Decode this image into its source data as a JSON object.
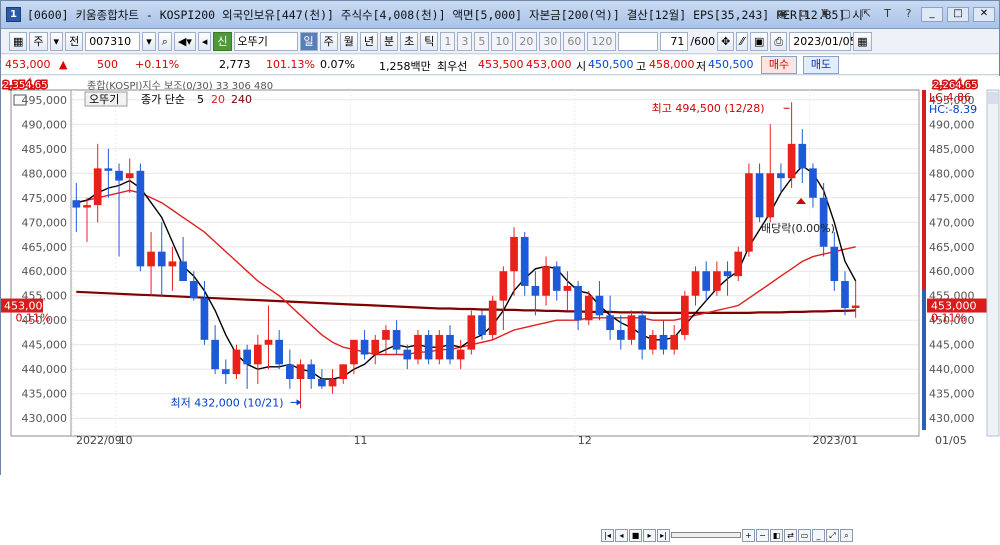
{
  "window": {
    "app_number": "1",
    "title": "[0600] 키움종합차트 - KOSPI200 외국인보유[447(천)] 주식수[4,008(천)] 액면[5,000] 자본금[200(억)] 결산[12월] EPS[35,243] PER[12.85] 시",
    "icons": [
      "chat-icon",
      "copy-icon",
      "lock-icon",
      "restore-icon",
      "resize-icon",
      "text-size-icon",
      "help-icon"
    ],
    "icon_glyphs": [
      "◉",
      "⧉",
      "♜",
      "▢",
      "⇱",
      "T",
      "?"
    ],
    "buttons": {
      "minimize": "_",
      "maximize": "□",
      "close": "✕"
    }
  },
  "toolbar": {
    "market": "주",
    "range": "전",
    "code": "007310",
    "period_type": "오뚜기",
    "period_tabs": [
      "일",
      "주",
      "월",
      "년",
      "분",
      "초",
      "틱"
    ],
    "intervals": [
      "1",
      "3",
      "5",
      "10",
      "20",
      "30",
      "60",
      "120"
    ],
    "count": "71",
    "count_total": "/600",
    "date": "2023/01/05"
  },
  "quote": {
    "price": "453,000",
    "arrow": "▲",
    "change": "500",
    "change_pct": "+0.11%",
    "volume": "2,773",
    "vol_ratio": "101.13%",
    "turnover": "0.07%",
    "amount": "1,258백만",
    "best_label": "최우선",
    "best_sell": "453,500",
    "best_buy": "453,000",
    "open_label": "시",
    "open": "450,500",
    "high_label": "고",
    "high": "458,000",
    "low_label": "저",
    "low": "450,500",
    "buy_btn": "매수",
    "sell_btn": "매도"
  },
  "overlay_top": {
    "left_index": "2,354.65",
    "overlay_label": "종합(KOSPI)지수 보조(0/30)  33  306  480",
    "right_index": "2,264.65"
  },
  "legend": {
    "series_name": "오뚜기",
    "ma_label": "종가 단순",
    "ma_periods": [
      "5",
      "20",
      "240"
    ],
    "ma_colors": [
      "#000000",
      "#e02020",
      "#800000"
    ]
  },
  "right_info": {
    "lc": "LC:4.86",
    "hc": "HC:-8.39"
  },
  "price_axis": [
    "495,000",
    "490,000",
    "485,000",
    "480,000",
    "475,000",
    "470,000",
    "465,000",
    "460,000",
    "455,000",
    "450,000",
    "445,000",
    "440,000",
    "435,000",
    "430,000"
  ],
  "current_price": {
    "value": "453,000",
    "pct": "0.11%"
  },
  "annotations": {
    "high_text": "최고 494,500 (12/28)",
    "low_text": "최저 432,000 (10/21)",
    "dividend_text": "배당락(0.00%)"
  },
  "x_axis": [
    "2022/09",
    "10",
    "11",
    "12",
    "2023/01",
    "01/05"
  ],
  "colors": {
    "up": "#e8211b",
    "down": "#1f5ad6",
    "ma5": "#000000",
    "ma20": "#e02020",
    "ma240": "#800000"
  },
  "chart_data": {
    "type": "candlestick",
    "series_name": "오뚜기",
    "ylim": [
      428000,
      497000
    ],
    "yticks_step": 5000,
    "candles": [
      [
        474500,
        478000,
        468000,
        473000
      ],
      [
        473000,
        475000,
        466000,
        473500
      ],
      [
        473500,
        486000,
        470000,
        481000
      ],
      [
        481000,
        485000,
        475000,
        480500
      ],
      [
        480500,
        482000,
        463000,
        478500
      ],
      [
        479000,
        483000,
        476000,
        480000
      ],
      [
        480500,
        482000,
        460000,
        461000
      ],
      [
        461000,
        468000,
        455000,
        464000
      ],
      [
        464000,
        470000,
        455000,
        461000
      ],
      [
        461000,
        465000,
        456000,
        462000
      ],
      [
        462000,
        467000,
        458000,
        458000
      ],
      [
        458000,
        460000,
        454000,
        454500
      ],
      [
        454500,
        458000,
        445000,
        446000
      ],
      [
        446000,
        449000,
        439000,
        440000
      ],
      [
        440000,
        442000,
        437000,
        439000
      ],
      [
        439000,
        445000,
        438000,
        444000
      ],
      [
        444000,
        445000,
        436000,
        441000
      ],
      [
        441000,
        447000,
        437000,
        445000
      ],
      [
        445000,
        453000,
        440000,
        446000
      ],
      [
        446000,
        448000,
        440000,
        441000
      ],
      [
        441000,
        444000,
        436000,
        438000
      ],
      [
        438000,
        442000,
        432000,
        441000
      ],
      [
        441000,
        442000,
        436000,
        438000
      ],
      [
        438000,
        440000,
        436000,
        436500
      ],
      [
        436500,
        440000,
        435000,
        438000
      ],
      [
        438000,
        441000,
        437000,
        441000
      ],
      [
        441000,
        445000,
        439000,
        446000
      ],
      [
        446000,
        448000,
        442000,
        443000
      ],
      [
        443000,
        447000,
        441000,
        446000
      ],
      [
        446000,
        449000,
        443000,
        448000
      ],
      [
        448000,
        450000,
        443000,
        444000
      ],
      [
        444000,
        445000,
        440000,
        442000
      ],
      [
        442000,
        448000,
        441000,
        447000
      ],
      [
        447000,
        448000,
        441000,
        442000
      ],
      [
        442000,
        448000,
        441000,
        447000
      ],
      [
        447000,
        449000,
        441000,
        442000
      ],
      [
        442000,
        446000,
        440000,
        444000
      ],
      [
        444000,
        452000,
        443000,
        451000
      ],
      [
        451000,
        452000,
        446000,
        447000
      ],
      [
        447000,
        455000,
        446000,
        454000
      ],
      [
        454000,
        461000,
        448000,
        460000
      ],
      [
        460000,
        469000,
        455000,
        467000
      ],
      [
        467000,
        468000,
        455000,
        457000
      ],
      [
        457000,
        460000,
        451000,
        455000
      ],
      [
        455000,
        463000,
        453000,
        461000
      ],
      [
        461000,
        462000,
        454000,
        456000
      ],
      [
        456000,
        460000,
        452000,
        457000
      ],
      [
        457000,
        458000,
        448000,
        450000
      ],
      [
        450000,
        456000,
        449000,
        455000
      ],
      [
        455000,
        458000,
        450000,
        451000
      ],
      [
        451000,
        455000,
        446000,
        448000
      ],
      [
        448000,
        451000,
        444000,
        446000
      ],
      [
        446000,
        452000,
        445000,
        451000
      ],
      [
        451000,
        452000,
        442000,
        444000
      ],
      [
        444000,
        448000,
        443000,
        447000
      ],
      [
        447000,
        450000,
        443000,
        444000
      ],
      [
        444000,
        449000,
        443000,
        447000
      ],
      [
        447000,
        456000,
        446000,
        455000
      ],
      [
        455000,
        461000,
        453000,
        460000
      ],
      [
        460000,
        462000,
        454000,
        456000
      ],
      [
        456000,
        462000,
        455000,
        460000
      ],
      [
        460000,
        462000,
        455000,
        459000
      ],
      [
        459000,
        465000,
        458000,
        464000
      ],
      [
        464000,
        482000,
        463000,
        480000
      ],
      [
        480000,
        482000,
        470000,
        471000
      ],
      [
        471000,
        490000,
        470000,
        480000
      ],
      [
        480000,
        482000,
        476000,
        479000
      ],
      [
        479000,
        494500,
        477000,
        486000
      ],
      [
        486000,
        489000,
        478000,
        481000
      ],
      [
        481000,
        482000,
        473000,
        475000
      ],
      [
        475000,
        478000,
        463000,
        465000
      ],
      [
        465000,
        468000,
        456000,
        458000
      ],
      [
        458000,
        460000,
        451000,
        452500
      ],
      [
        452500,
        458000,
        450500,
        453000
      ]
    ],
    "ma5": [
      474000,
      474500,
      476000,
      477000,
      477500,
      478500,
      477000,
      474000,
      471000,
      466000,
      461000,
      459000,
      456000,
      452000,
      447000,
      443000,
      441000,
      440000,
      440500,
      440500,
      441000,
      440000,
      439500,
      438000,
      438000,
      438500,
      440000,
      441000,
      443000,
      444000,
      445000,
      444500,
      445000,
      444500,
      444500,
      445000,
      444500,
      446000,
      447000,
      449000,
      452000,
      456000,
      458500,
      460500,
      461000,
      460500,
      458000,
      456000,
      455500,
      453000,
      451000,
      449500,
      448500,
      447000,
      446000,
      446000,
      446500,
      449000,
      451500,
      454000,
      456500,
      458500,
      460000,
      465000,
      468500,
      472000,
      476000,
      479000,
      481500,
      480000,
      476500,
      470000,
      462000,
      458000
    ],
    "ma20": [
      474000,
      474500,
      475000,
      475500,
      476000,
      476500,
      476000,
      475000,
      474000,
      472500,
      471000,
      469500,
      468000,
      466000,
      464000,
      462000,
      460000,
      458000,
      456500,
      455000,
      453000,
      451000,
      449000,
      447000,
      445500,
      444500,
      444000,
      443500,
      443000,
      443000,
      443000,
      443000,
      443500,
      443500,
      444000,
      444000,
      444500,
      445000,
      445500,
      446000,
      447000,
      448000,
      448500,
      449000,
      449500,
      450000,
      450000,
      450000,
      450500,
      450500,
      450500,
      450500,
      450500,
      450500,
      450000,
      450000,
      450000,
      450500,
      451000,
      451500,
      452000,
      452500,
      453000,
      454500,
      456000,
      457500,
      459000,
      460500,
      462000,
      463000,
      463500,
      464000,
      464500,
      465000
    ],
    "ma240": [
      455800,
      455700,
      455600,
      455500,
      455400,
      455300,
      455200,
      455100,
      455000,
      454900,
      454800,
      454700,
      454600,
      454500,
      454400,
      454300,
      454200,
      454100,
      454000,
      453900,
      453800,
      453700,
      453600,
      453500,
      453400,
      453300,
      453200,
      453100,
      453000,
      452900,
      452800,
      452700,
      452600,
      452500,
      452400,
      452400,
      452300,
      452300,
      452200,
      452200,
      452100,
      452100,
      452000,
      452000,
      451900,
      451900,
      451800,
      451800,
      451700,
      451700,
      451700,
      451600,
      451600,
      451600,
      451500,
      451500,
      451500,
      451500,
      451500,
      451500,
      451500,
      451500,
      451500,
      451500,
      451600,
      451600,
      451600,
      451700,
      451700,
      451800,
      451800,
      451900,
      451900,
      452000
    ]
  }
}
